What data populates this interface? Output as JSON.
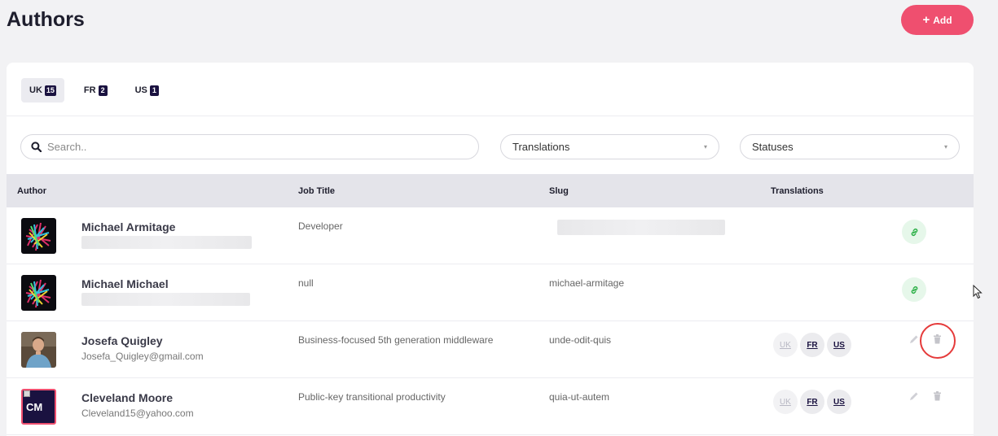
{
  "header": {
    "title": "Authors",
    "add_label": "Add"
  },
  "tabs": [
    {
      "label": "UK",
      "count": "15",
      "active": true
    },
    {
      "label": "FR",
      "count": "2",
      "active": false
    },
    {
      "label": "US",
      "count": "1",
      "active": false
    }
  ],
  "filters": {
    "search_placeholder": "Search..",
    "translations_label": "Translations",
    "statuses_label": "Statuses"
  },
  "table": {
    "columns": [
      "Author",
      "Job Title",
      "Slug",
      "Translations"
    ],
    "rows": [
      {
        "name": "Michael Armitage",
        "email": "",
        "job_title": "Developer",
        "slug": "",
        "translations": [],
        "actions": [
          "link"
        ]
      },
      {
        "name": "Michael Michael",
        "email": "",
        "job_title": "null",
        "slug": "michael-armitage",
        "translations": [],
        "actions": [
          "link"
        ]
      },
      {
        "name": "Josefa Quigley",
        "email": "Josefa_Quigley@gmail.com",
        "job_title": "Business-focused 5th generation middleware",
        "slug": "unde-odit-quis",
        "translations": [
          "UK",
          "FR",
          "US"
        ],
        "actions": [
          "edit",
          "delete"
        ]
      },
      {
        "name": "Cleveland Moore",
        "email": "Cleveland15@yahoo.com",
        "avatar_initials": "CM",
        "job_title": "Public-key transitional productivity",
        "slug": "quia-ut-autem",
        "translations": [
          "UK",
          "FR",
          "US"
        ],
        "actions": [
          "edit",
          "delete"
        ]
      }
    ]
  },
  "colors": {
    "accent": "#ef4f6f",
    "badge": "#1a1240",
    "link_green": "#2fb14a",
    "highlight_ring": "#e53a3a"
  }
}
